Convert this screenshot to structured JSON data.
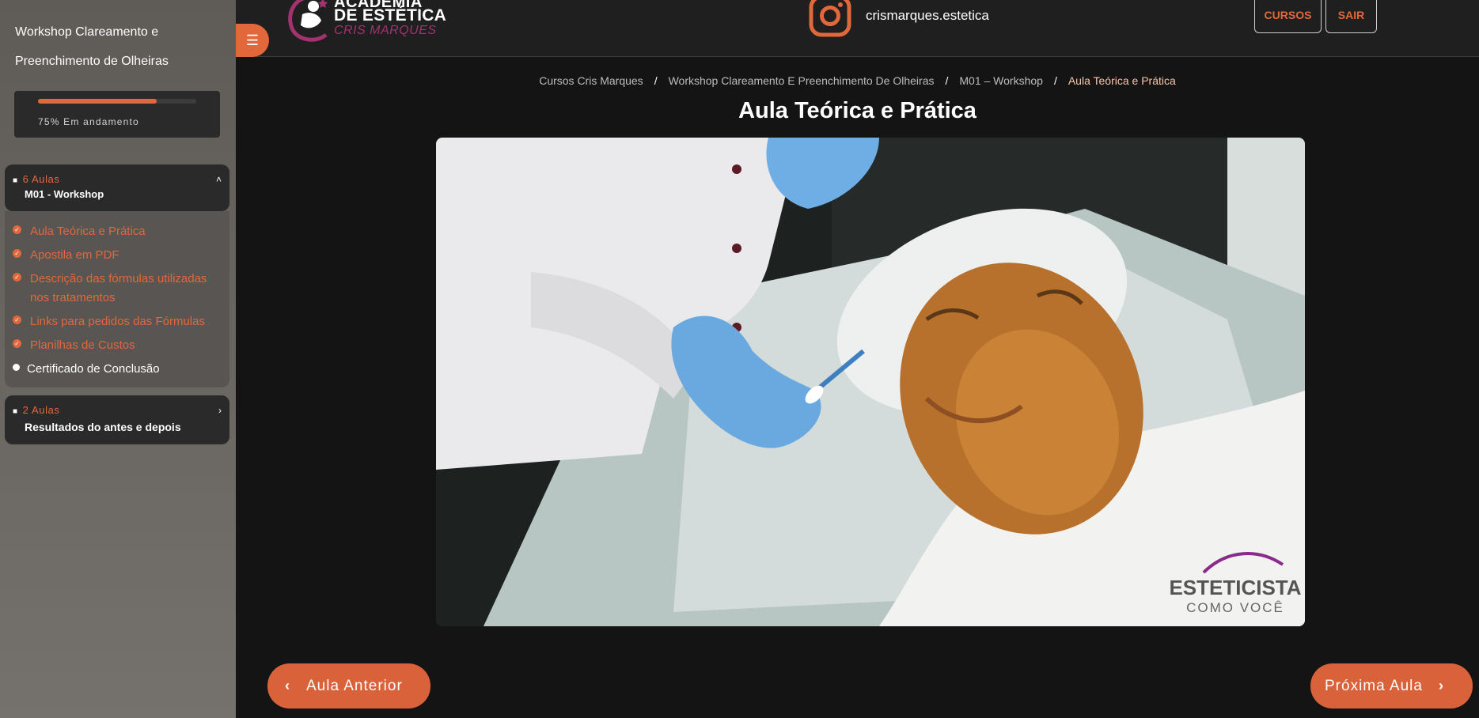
{
  "sidebar": {
    "course_title": "Workshop Clareamento e Preenchimento de Olheiras",
    "progress": {
      "percent": 75,
      "label": "75% Em andamento"
    },
    "modules": [
      {
        "count": "6 Aulas",
        "name": "M01 - Workshop",
        "chevron": "˄",
        "lessons": [
          {
            "label": "Aula Teórica e Prática",
            "status": "done"
          },
          {
            "label": "Apostila em PDF",
            "status": "done"
          },
          {
            "label": "Descrição das fórmulas utilizadas nos tratamentos",
            "status": "done"
          },
          {
            "label": "Links para pedidos das Fórmulas",
            "status": "done"
          },
          {
            "label": "Planilhas de Custos",
            "status": "done"
          },
          {
            "label": "Certificado de Conclusão",
            "status": "pending"
          }
        ]
      },
      {
        "count": "2 Aulas",
        "name": "Resultados do antes e depois",
        "chevron": "›"
      }
    ]
  },
  "header": {
    "menu_icon": "☰",
    "logo": {
      "line1": "ACADEMIA",
      "line2": "DE ESTÉTICA",
      "line3": "CRIS MARQUES"
    },
    "instagram_handle": "crismarques.estetica",
    "buttons": {
      "cursos": "CURSOS",
      "sair": "SAIR"
    }
  },
  "breadcrumb": {
    "items": [
      "Cursos Cris Marques",
      "Workshop Clareamento E Preenchimento De Olheiras",
      "M01 – Workshop"
    ],
    "current": "Aula Teórica e Prática",
    "separator": "/"
  },
  "page_title": "Aula Teórica e Prática",
  "video": {
    "watermark_line1": "ESTETICISTA",
    "watermark_line2": "COMO VOCÊ"
  },
  "navigation": {
    "prev_label": "Aula Anterior",
    "next_label": "Próxima Aula",
    "prev_icon": "‹",
    "next_icon": "›"
  },
  "colors": {
    "accent": "#e2683b",
    "header_bg": "#1f1f1f",
    "page_bg": "#141414"
  }
}
